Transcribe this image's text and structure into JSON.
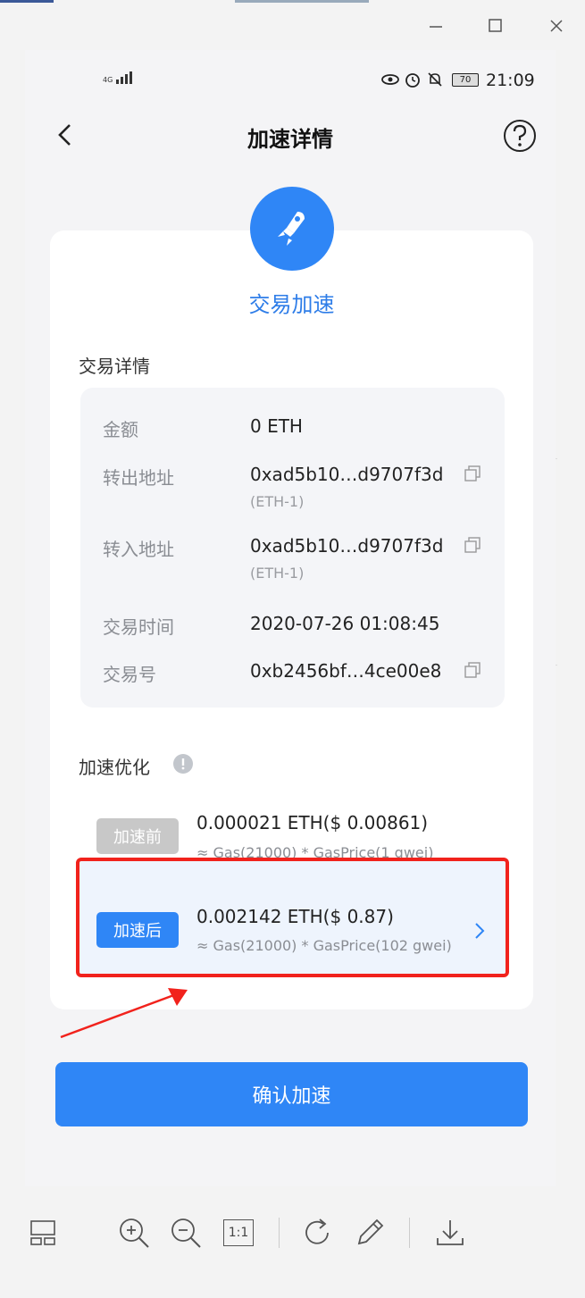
{
  "status_bar": {
    "network": "4G",
    "battery": "70",
    "time": "21:09"
  },
  "header": {
    "title": "加速详情"
  },
  "hero": {
    "title": "交易加速"
  },
  "details": {
    "section_label": "交易详情",
    "rows": [
      {
        "label": "金额",
        "value": "0 ETH"
      },
      {
        "label": "转出地址",
        "value": "0xad5b10…d9707f3d",
        "sub": "(ETH-1)"
      },
      {
        "label": "转入地址",
        "value": "0xad5b10…d9707f3d",
        "sub": "(ETH-1)"
      },
      {
        "label": "交易时间",
        "value": "2020-07-26 01:08:45"
      },
      {
        "label": "交易号",
        "value": "0xb2456bf…4ce00e8"
      }
    ]
  },
  "optimize": {
    "section_label": "加速优化",
    "before": {
      "tag": "加速前",
      "main": "0.000021 ETH($ 0.00861)",
      "sub": "≈ Gas(21000) * GasPrice(1 gwei)"
    },
    "after": {
      "tag": "加速后",
      "main": "0.002142 ETH($ 0.87)",
      "sub": "≈ Gas(21000) * GasPrice(102 gwei)"
    }
  },
  "confirm_label": "确认加速",
  "viewer_toolbar": {
    "actual_size_label": "1:1"
  },
  "colors": {
    "accent": "#2f86f6",
    "highlight": "#f1221c"
  }
}
